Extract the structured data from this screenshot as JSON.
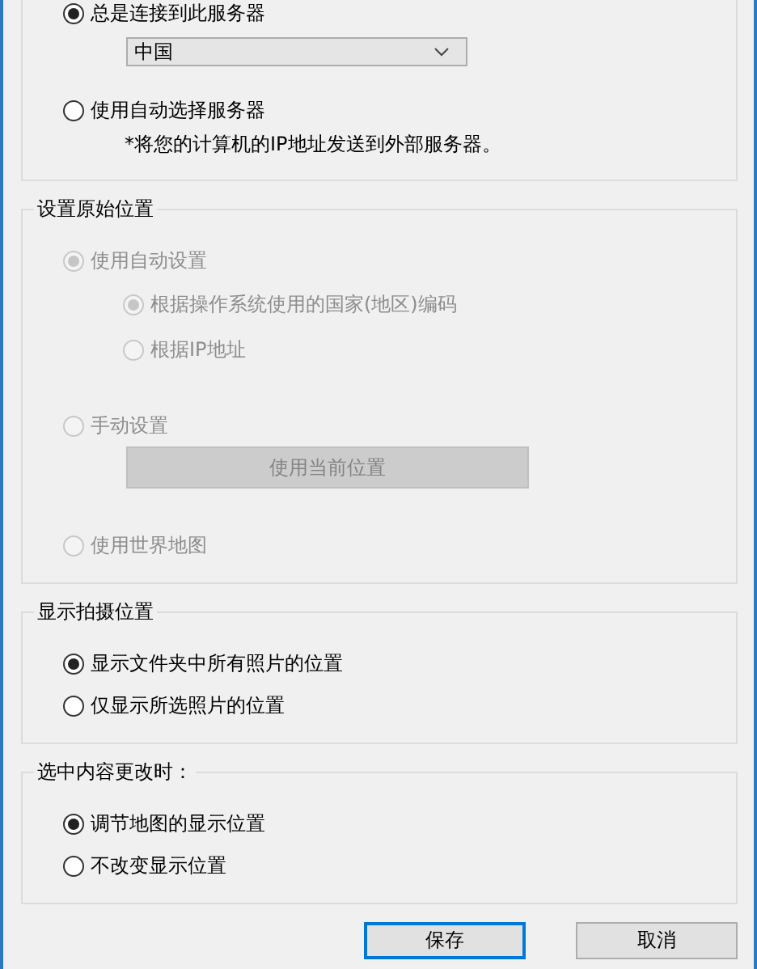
{
  "groups": [
    {
      "items": [
        {
          "kind": "radio",
          "label": "总是连接到此服务器",
          "selected": true,
          "disabled": false
        },
        {
          "kind": "dropdown",
          "value": "中国"
        },
        {
          "kind": "radio",
          "label": "使用自动选择服务器",
          "selected": false,
          "disabled": false
        },
        {
          "kind": "note",
          "text": "*将您的计算机的IP地址发送到外部服务器。"
        }
      ]
    },
    {
      "title": "设置原始位置",
      "items": [
        {
          "kind": "radio",
          "label": "使用自动设置",
          "selected": true,
          "disabled": true,
          "children": [
            {
              "label": "根据操作系统使用的国家(地区)编码",
              "selected": true,
              "disabled": true
            },
            {
              "label": "根据IP地址",
              "selected": false,
              "disabled": true
            }
          ]
        },
        {
          "kind": "radio",
          "label": "手动设置",
          "selected": false,
          "disabled": true
        },
        {
          "kind": "button",
          "label": "使用当前位置",
          "disabled": true
        },
        {
          "kind": "radio",
          "label": "使用世界地图",
          "selected": false,
          "disabled": true
        }
      ]
    },
    {
      "title": "显示拍摄位置",
      "items": [
        {
          "kind": "radio",
          "label": "显示文件夹中所有照片的位置",
          "selected": true,
          "disabled": false
        },
        {
          "kind": "radio",
          "label": "仅显示所选照片的位置",
          "selected": false,
          "disabled": false
        }
      ]
    },
    {
      "title": "选中内容更改时：",
      "items": [
        {
          "kind": "radio",
          "label": "调节地图的显示位置",
          "selected": true,
          "disabled": false
        },
        {
          "kind": "radio",
          "label": "不改变显示位置",
          "selected": false,
          "disabled": false
        }
      ]
    }
  ],
  "buttons": [
    {
      "label": "保存",
      "focused": true
    },
    {
      "label": "取消",
      "focused": false
    }
  ]
}
